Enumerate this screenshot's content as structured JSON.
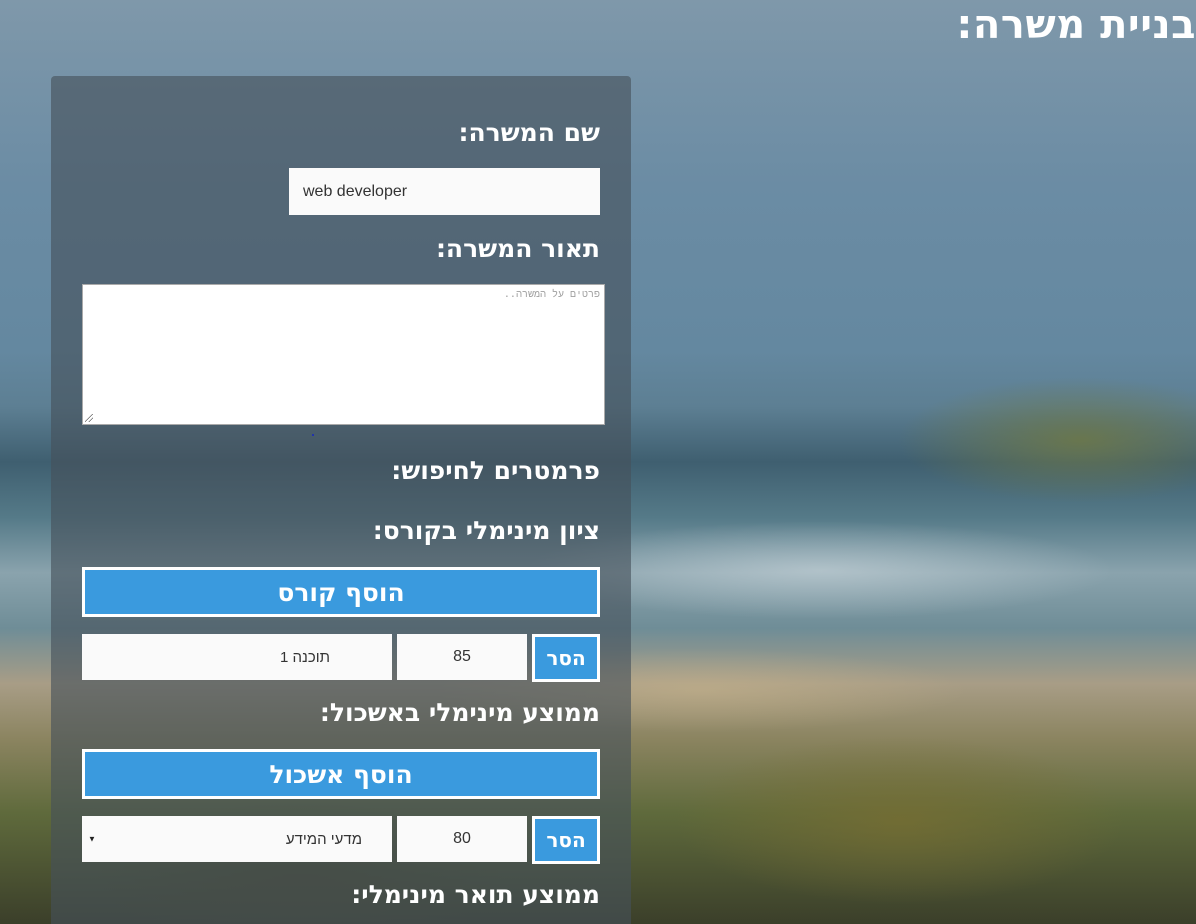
{
  "page": {
    "title": "בניית משרה:"
  },
  "form": {
    "job_name_label": "שם המשרה:",
    "job_name_value": "web developer",
    "job_description_label": "תאור המשרה:",
    "job_description_placeholder": "פרטים על המשרה..",
    "search_params_label": "פרמטרים לחיפוש:",
    "min_course_grade_label": "ציון מינימלי בקורס:",
    "add_course_label": "הוסף קורס",
    "courses": [
      {
        "name": "תוכנה 1",
        "grade": "85",
        "remove_label": "הסר"
      }
    ],
    "min_cluster_avg_label": "ממוצע מינימלי באשכול:",
    "add_cluster_label": "הוסף אשכול",
    "clusters": [
      {
        "name": "מדעי המידע",
        "grade": "80",
        "remove_label": "הסר"
      }
    ],
    "min_degree_avg_label": "ממוצע תואר מינימלי:"
  },
  "colors": {
    "accent": "#3a9ade",
    "button_border": "#ffffff",
    "text": "#ffffff"
  }
}
